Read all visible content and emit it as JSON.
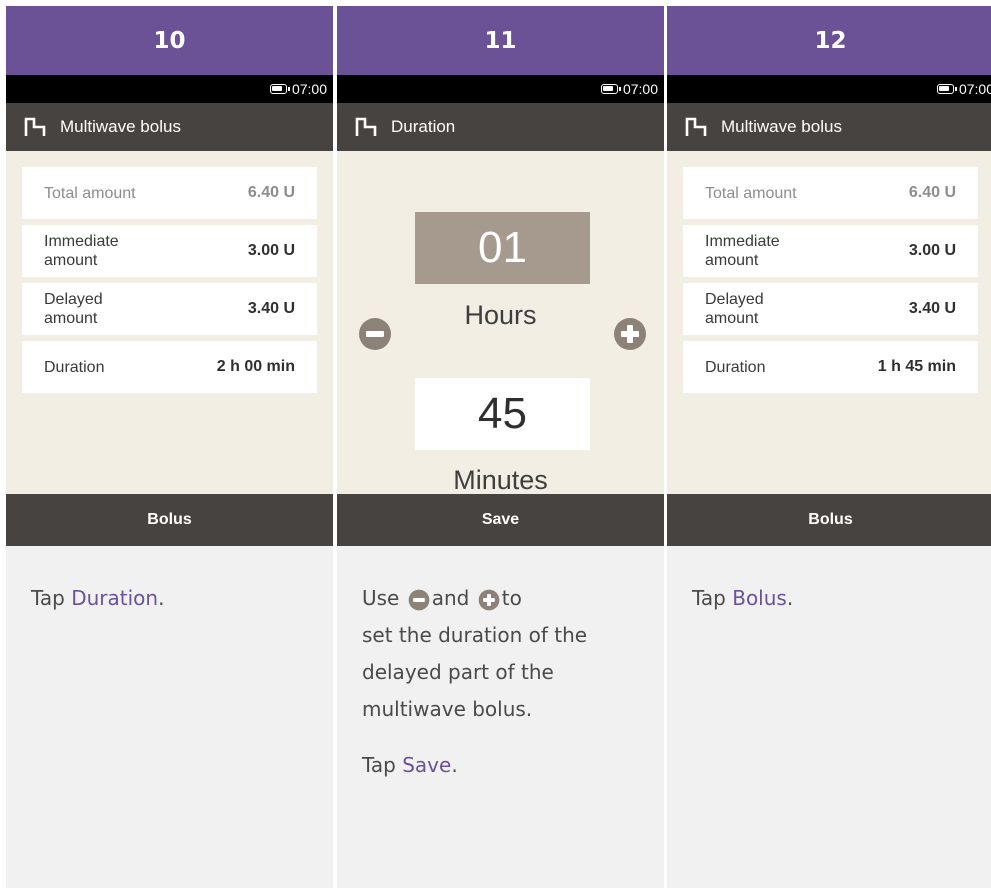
{
  "steps": [
    {
      "number": "10",
      "time": "07:00",
      "screen_title": "Multiwave bolus",
      "rows": [
        {
          "label": "Total amount",
          "value": "6.40 U"
        },
        {
          "label": "Immediate amount",
          "value": "3.00 U"
        },
        {
          "label": "Delayed amount",
          "value": "3.40 U"
        },
        {
          "label": "Duration",
          "value": "2 h 00 min"
        }
      ],
      "button": "Bolus",
      "instruction_prefix": "Tap ",
      "instruction_link": "Duration",
      "instruction_suffix": "."
    },
    {
      "number": "11",
      "time": "07:00",
      "screen_title": "Duration",
      "hours_value": "01",
      "hours_label": "Hours",
      "minutes_value": "45",
      "minutes_label": "Minutes",
      "button": "Save",
      "instruction_use": "Use",
      "instruction_and": "and",
      "instruction_to": "to",
      "instruction_rest": "set the duration of the delayed part of the multiwave bolus.",
      "instruction2_prefix": "Tap ",
      "instruction2_link": "Save",
      "instruction2_suffix": "."
    },
    {
      "number": "12",
      "time": "07:00",
      "screen_title": "Multiwave bolus",
      "rows": [
        {
          "label": "Total amount",
          "value": "6.40 U"
        },
        {
          "label": "Immediate amount",
          "value": "3.00 U"
        },
        {
          "label": "Delayed amount",
          "value": "3.40 U"
        },
        {
          "label": "Duration",
          "value": "1 h 45 min"
        }
      ],
      "button": "Bolus",
      "instruction_prefix": "Tap ",
      "instruction_link": "Bolus",
      "instruction_suffix": "."
    }
  ],
  "icons": {
    "title": "bolus-wave-icon",
    "minus": "minus-icon",
    "plus": "plus-icon",
    "battery": "battery-icon"
  },
  "colors": {
    "header": "#6b5296",
    "link": "#6b5296",
    "bar": "#474340",
    "screen_bg": "#f2eee4",
    "hours_box": "#a59a8d",
    "control": "#8c8278"
  }
}
